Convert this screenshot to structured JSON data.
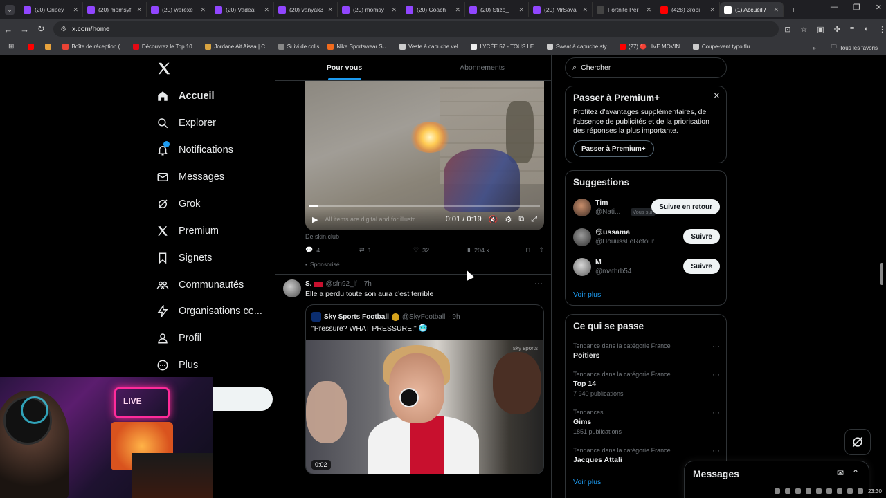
{
  "browser": {
    "tabs": [
      {
        "label": "(20) Gripey",
        "color": "#9146ff"
      },
      {
        "label": "(20) momsyf",
        "color": "#9146ff"
      },
      {
        "label": "(20) werexe",
        "color": "#9146ff"
      },
      {
        "label": "(20) Vadeal",
        "color": "#9146ff"
      },
      {
        "label": "(20) vanyak3",
        "color": "#9146ff"
      },
      {
        "label": "(20) momsy",
        "color": "#9146ff"
      },
      {
        "label": "(20) Coach",
        "color": "#9146ff"
      },
      {
        "label": "(20) Stizo_",
        "color": "#9146ff"
      },
      {
        "label": "(20) MrSava",
        "color": "#9146ff"
      },
      {
        "label": "Fortnite Per",
        "color": "#444444"
      },
      {
        "label": "(428) 3robi",
        "color": "#ff0000"
      },
      {
        "label": "(1) Accueil /",
        "color": "#ffffff",
        "active": true
      }
    ],
    "url": "x.com/home",
    "bookmarks": [
      {
        "label": "",
        "color": "#ff0000"
      },
      {
        "label": "",
        "color": "#e8a33d"
      },
      {
        "label": "Boîte de réception (...",
        "color": "#ea4335"
      },
      {
        "label": "Découvrez le Top 10...",
        "color": "#e50914"
      },
      {
        "label": "Jordane Ait Aissa | C...",
        "color": "#d9a441"
      },
      {
        "label": "Suivi de colis",
        "color": "#888888"
      },
      {
        "label": "Nike Sportswear SU...",
        "color": "#f26b1d"
      },
      {
        "label": "Veste à capuche vel...",
        "color": "#cccccc"
      },
      {
        "label": "LYCÉE 57 - TOUS LE...",
        "color": "#eeeeee"
      },
      {
        "label": "Sweat à capuche sty...",
        "color": "#cccccc"
      },
      {
        "label": "(27) 🔴 LIVE MOVIN...",
        "color": "#ff0000"
      },
      {
        "label": "Coupe-vent typo flu...",
        "color": "#cccccc"
      }
    ],
    "all_bookmarks": "Tous les favoris"
  },
  "nav": {
    "items": [
      {
        "label": "Accueil",
        "icon": "home-icon"
      },
      {
        "label": "Explorer",
        "icon": "search-icon"
      },
      {
        "label": "Notifications",
        "icon": "bell-icon"
      },
      {
        "label": "Messages",
        "icon": "mail-icon"
      },
      {
        "label": "Grok",
        "icon": "grok-icon"
      },
      {
        "label": "Premium",
        "icon": "x-icon"
      },
      {
        "label": "Signets",
        "icon": "bookmark-icon"
      },
      {
        "label": "Communautés",
        "icon": "people-icon"
      },
      {
        "label": "Organisations ce...",
        "icon": "lightning-icon"
      },
      {
        "label": "Profil",
        "icon": "person-icon"
      },
      {
        "label": "Plus",
        "icon": "more-circle-icon"
      }
    ],
    "notif_count": "1",
    "post_button_fragment": "r"
  },
  "feed": {
    "tabs": [
      "Pour vous",
      "Abonnements"
    ],
    "ad": {
      "video_subtitle": "All items are digital and for illustr...",
      "video_time": "0:01 / 0:19",
      "source": "De skin.club",
      "replies": "4",
      "reposts": "1",
      "likes": "32",
      "views": "204 k",
      "sponsored": "Sponsorisé"
    },
    "tweet": {
      "name": "S.",
      "handle": "@sfn92_lf",
      "time": "· 7h",
      "text": "Elle a perdu toute son aura c'est terrible",
      "quote": {
        "name": "Sky Sports Football",
        "handle": "@SkyFootball",
        "time": "· 9h",
        "text": "\"Pressure? WHAT PRESSURE!\" 🥶",
        "watermark": "sky sports",
        "duration": "0:02"
      }
    }
  },
  "right": {
    "search_placeholder": "Chercher",
    "premium": {
      "title": "Passer à Premium+",
      "text": "Profitez d'avantages supplémentaires, de l'absence de publicités et de la priorisation des réponses la plus importante.",
      "button": "Passer à Premium+"
    },
    "suggestions": {
      "title": "Suggestions",
      "items": [
        {
          "name": "Tim",
          "handle": "@Nati...",
          "follows_you": "Vous suit",
          "button": "Suivre en retour"
        },
        {
          "name": "😏ussama",
          "handle": "@HouussLeRetour",
          "button": "Suivre"
        },
        {
          "name": "M",
          "handle": "@mathrb54",
          "button": "Suivre"
        }
      ],
      "more": "Voir plus"
    },
    "trends": {
      "title": "Ce qui se passe",
      "items": [
        {
          "context": "Tendance dans la catégorie France",
          "name": "Poitiers",
          "posts": ""
        },
        {
          "context": "Tendance dans la catégorie France",
          "name": "Top 14",
          "posts": "7 940 publications"
        },
        {
          "context": "Tendances",
          "name": "Gims",
          "posts": "1851 publications"
        },
        {
          "context": "Tendance dans la catégorie France",
          "name": "Jacques Attali",
          "posts": ""
        }
      ],
      "more": "Voir plus"
    }
  },
  "messages_drawer": {
    "title": "Messages"
  },
  "webcam": {
    "sign": "LIVE"
  },
  "system": {
    "clock": "23:30"
  }
}
